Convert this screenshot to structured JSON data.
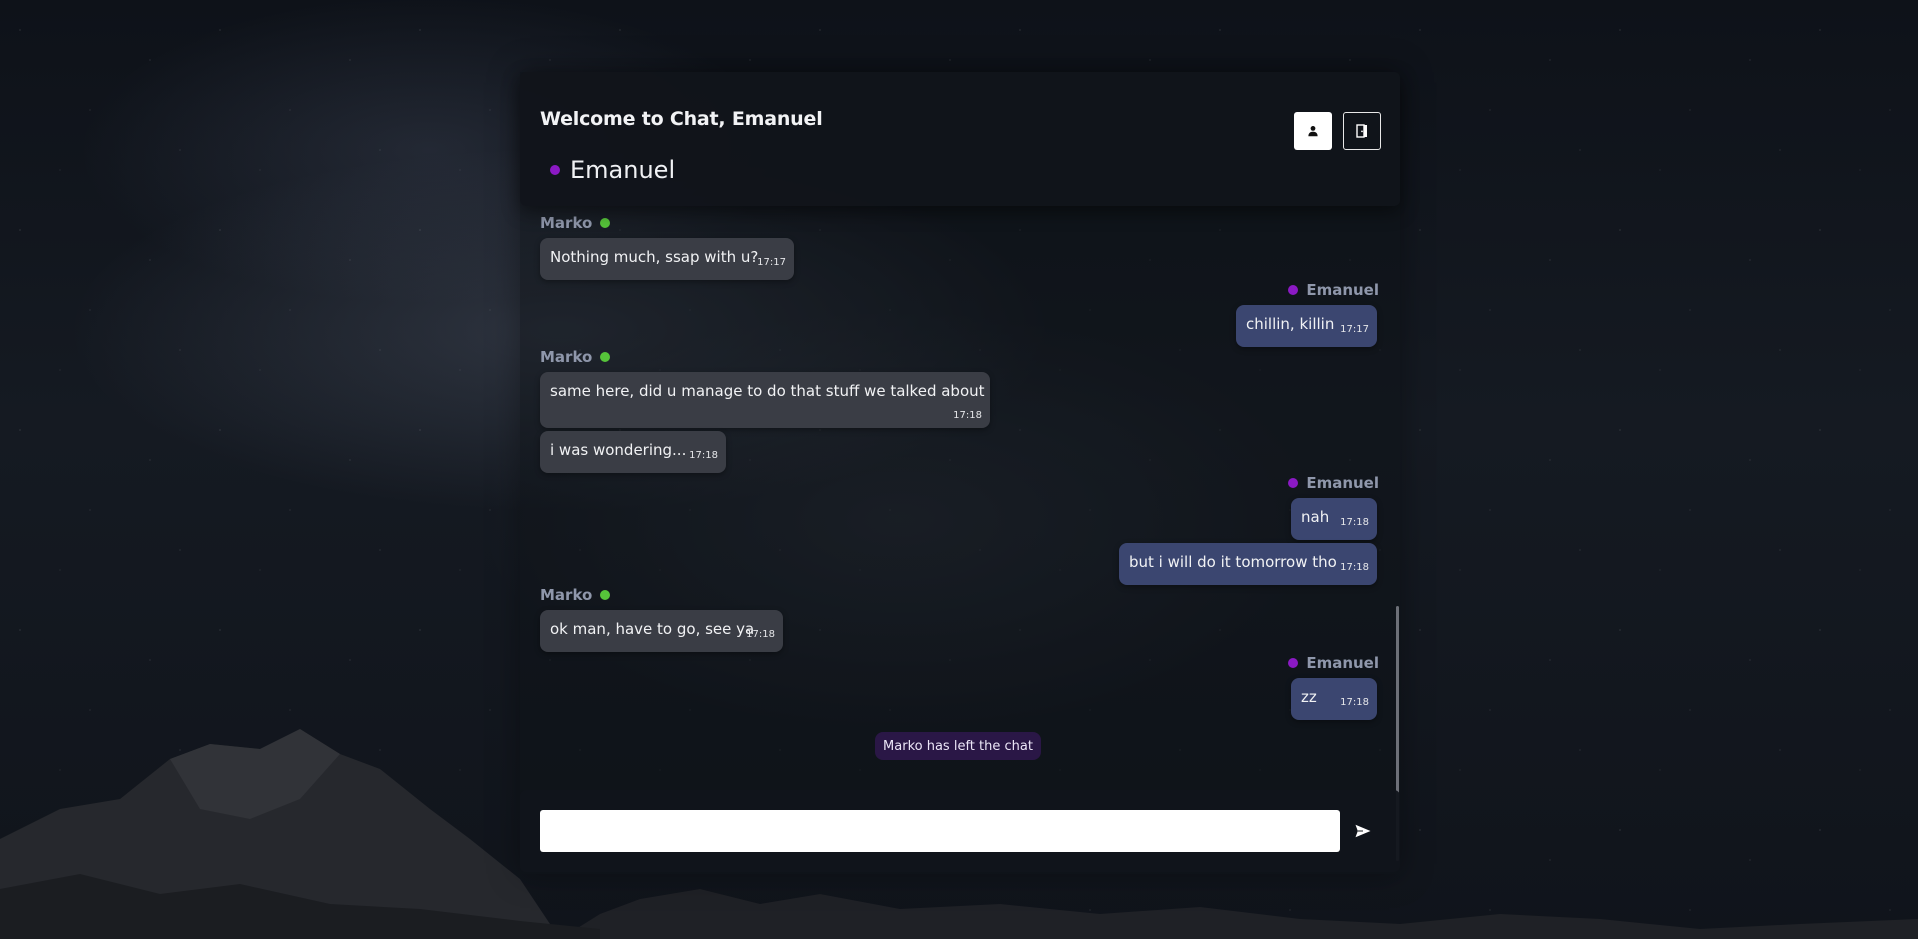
{
  "header": {
    "title": "Welcome to Chat, Emanuel",
    "current_user": "Emanuel",
    "status_color": "#8b19c4"
  },
  "icons": {
    "profile": "user-icon",
    "logout": "logout-icon",
    "send": "send-icon"
  },
  "colors": {
    "online_dot": "#56c43a",
    "self_dot": "#8b19c4",
    "incoming_bubble": "#3a3d45",
    "outgoing_bubble": "#3b4670",
    "system_notice": "#2a1746"
  },
  "messages": {
    "g1_sender": "Marko",
    "m1": {
      "text": "Nothing much, ssap with u?",
      "time": "17:17"
    },
    "g2_sender": "Emanuel",
    "m2": {
      "text": "chillin, killin",
      "time": "17:17"
    },
    "g3_sender": "Marko",
    "m3": {
      "text": "same here, did u manage to do that stuff we talked about",
      "time": "17:18"
    },
    "m4": {
      "text": "i was wondering...",
      "time": "17:18"
    },
    "g4_sender": "Emanuel",
    "m5": {
      "text": "nah",
      "time": "17:18"
    },
    "m6": {
      "text": "but i will do it tomorrow tho",
      "time": "17:18"
    },
    "g5_sender": "Marko",
    "m7": {
      "text": "ok man, have to go, see ya",
      "time": "17:18"
    },
    "g6_sender": "Emanuel",
    "m8": {
      "text": "zz",
      "time": "17:18"
    }
  },
  "system_notice": "Marko has left the chat",
  "input": {
    "value": "",
    "placeholder": ""
  }
}
